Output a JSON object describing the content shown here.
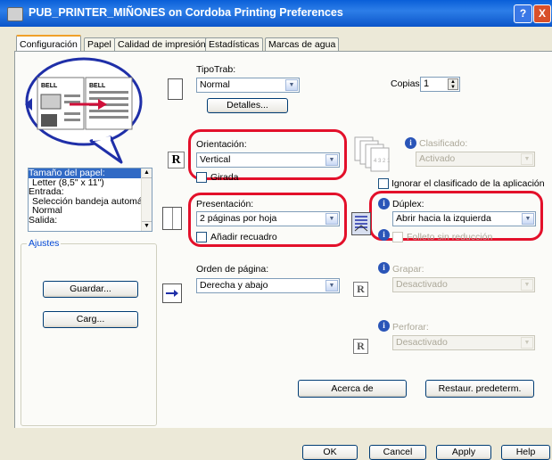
{
  "window": {
    "title": "PUB_PRINTER_MIÑONES on Cordoba Printing Preferences",
    "help": "?",
    "close": "X"
  },
  "tabs": [
    "Configuración",
    "Papel",
    "Calidad de impresión",
    "Estadísticas",
    "Marcas de agua"
  ],
  "preview": {
    "doc1": "BELL",
    "doc2": "BELL"
  },
  "list": {
    "items": [
      "Tamaño del papel:",
      "Letter (8,5\" x 11\")",
      "Entrada:",
      "Selección bandeja automátic",
      "Normal",
      "Salida:"
    ],
    "selected_index": 0
  },
  "settings_group": {
    "title": "Ajustes",
    "save": "Guardar...",
    "load": "Carg..."
  },
  "tipo_trab": {
    "label": "TipoTrab:",
    "value": "Normal",
    "details": "Detalles..."
  },
  "copies": {
    "label": "Copias:",
    "value": "1"
  },
  "orientation": {
    "label": "Orientación:",
    "value": "Vertical",
    "rotated": "Girada",
    "icon_letter": "R"
  },
  "presentation": {
    "label": "Presentación:",
    "value": "2 páginas por hoja",
    "add_border": "Añadir recuadro"
  },
  "page_order": {
    "label": "Orden de página:",
    "value": "Derecha y abajo"
  },
  "collate": {
    "label": "Clasificado:",
    "value": "Activado",
    "ignore": "Ignorar el clasificado de la aplicación",
    "pages": "4 3 2 1"
  },
  "duplex": {
    "label": "Dúplex:",
    "value": "Abrir hacia la izquierda",
    "booklet": "Folleto sin reducción"
  },
  "staple": {
    "label": "Grapar:",
    "value": "Desactivado",
    "icon_letter": "R"
  },
  "punch": {
    "label": "Perforar:",
    "value": "Desactivado",
    "icon_letter": "R"
  },
  "buttons": {
    "about": "Acerca de",
    "restore": "Restaur. predeterm."
  },
  "footer": {
    "ok": "OK",
    "cancel": "Cancel",
    "apply": "Apply",
    "help": "Help"
  }
}
